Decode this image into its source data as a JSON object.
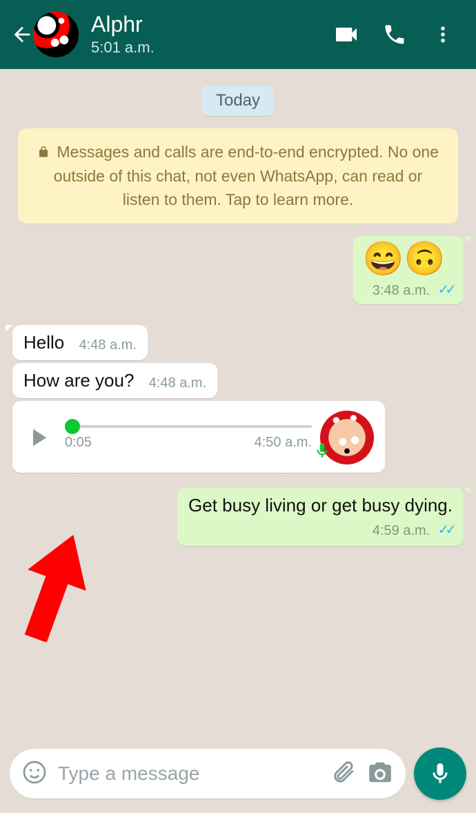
{
  "header": {
    "contact_name": "Alphr",
    "last_seen": "5:01 a.m."
  },
  "date_label": "Today",
  "encryption_notice": "Messages and calls are end-to-end encrypted. No one outside of this chat, not even WhatsApp, can read or listen to them. Tap to learn more.",
  "messages": {
    "m0": {
      "emoji": "😄🙃",
      "time": "3:48 a.m."
    },
    "m1": {
      "text": "Hello",
      "time": "4:48 a.m."
    },
    "m2": {
      "text": "How are you?",
      "time": "4:48 a.m."
    },
    "m3_voice": {
      "duration": "0:05",
      "time": "4:50 a.m."
    },
    "m4": {
      "text": "Get busy living or get busy dying.",
      "time": "4:59 a.m."
    }
  },
  "input": {
    "placeholder": "Type a message"
  }
}
